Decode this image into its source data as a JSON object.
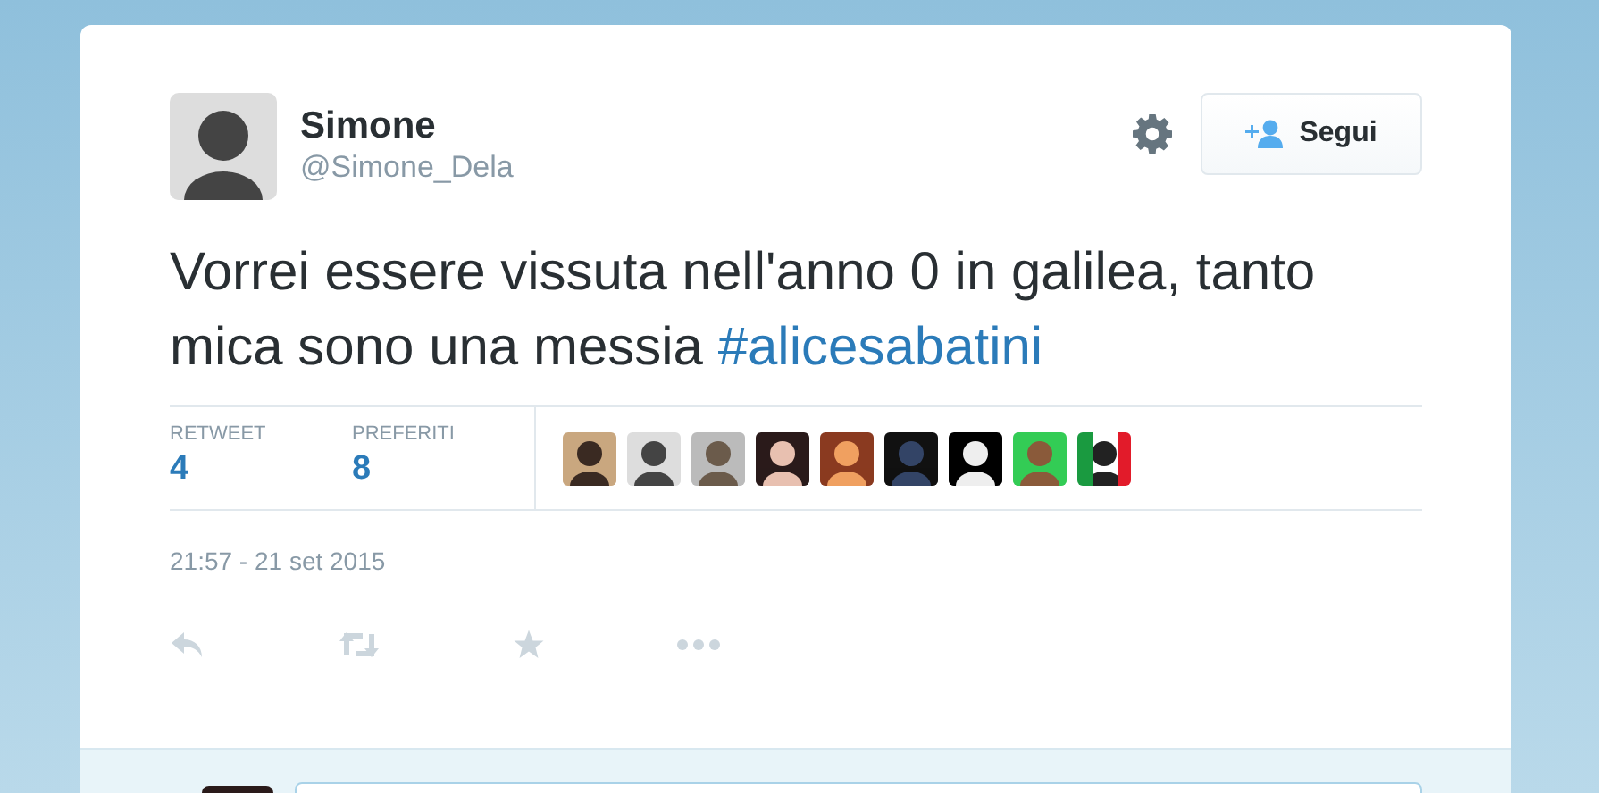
{
  "author": {
    "name": "Simone",
    "handle": "@Simone_Dela"
  },
  "follow_button": {
    "label": "Segui"
  },
  "tweet": {
    "text": "Vorrei essere vissuta nell'anno 0 in galilea, tanto mica sono una messia ",
    "hashtag": "#alicesabatini"
  },
  "stats": [
    {
      "label": "RETWEET",
      "value": "4"
    },
    {
      "label": "PREFERITI",
      "value": "8"
    }
  ],
  "timestamp": "21:57 - 21 set 2015",
  "actions": [
    {
      "kind": "reply"
    },
    {
      "kind": "retweet"
    },
    {
      "kind": "favorite"
    },
    {
      "kind": "more"
    }
  ]
}
